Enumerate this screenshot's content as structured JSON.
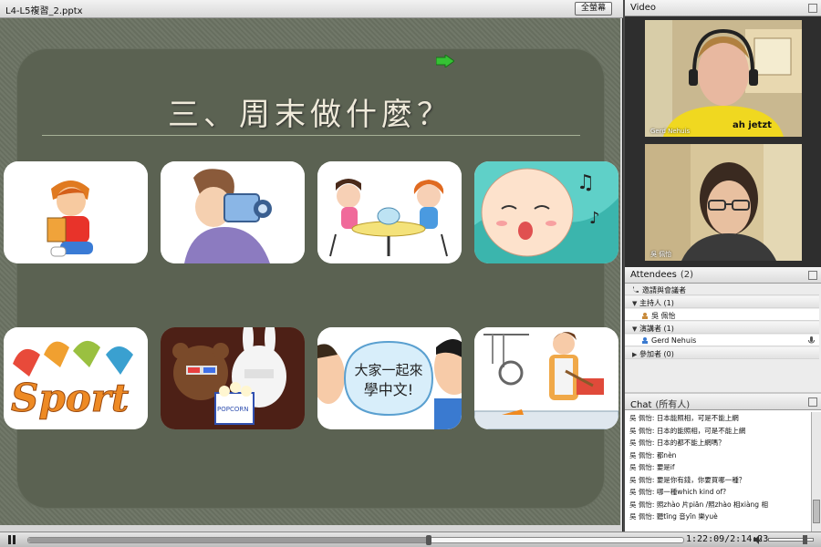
{
  "presentation": {
    "file_title": "L4-L5複習_2.pptx",
    "fullscreen_label": "全螢幕",
    "slide_heading": "三、周末做什麼？",
    "cards": [
      {
        "name": "reading-boy",
        "text": ""
      },
      {
        "name": "video-camera",
        "text": ""
      },
      {
        "name": "tea-party",
        "text": ""
      },
      {
        "name": "singing-face",
        "text": ""
      },
      {
        "name": "sport",
        "text": "Sport"
      },
      {
        "name": "movie-popcorn",
        "text": "POPCORN"
      },
      {
        "name": "learn-chinese",
        "line1": "大家一起來",
        "line2": "學中文!"
      },
      {
        "name": "cooking",
        "text": ""
      }
    ]
  },
  "playback": {
    "time_label": "1:22:09/2:14:23",
    "progress": 0.611,
    "volume": 0.82
  },
  "video": {
    "panel_title": "Video",
    "participants": [
      {
        "name": "Gerd Nehuis",
        "shirt_text": "ah jetzt"
      },
      {
        "name": "吳 佩怡"
      }
    ]
  },
  "attendees": {
    "panel_title": "Attendees",
    "count": "(2)",
    "invite_label": "邀請與會議者",
    "groups": [
      {
        "label": "主持人",
        "count": "(1)",
        "members": [
          "吳 佩怡"
        ]
      },
      {
        "label": "演講者",
        "count": "(1)",
        "members": [
          "Gerd Nehuis"
        ]
      },
      {
        "label": "參加者",
        "count": "(0)",
        "members": []
      }
    ]
  },
  "chat": {
    "panel_title": "Chat",
    "scope": "(所有人)",
    "messages": [
      {
        "who": "吳 佩怡:",
        "text": "日本能照相，可是不能上網"
      },
      {
        "who": "吳 佩怡:",
        "text": "日本的能照相，可是不能上網"
      },
      {
        "who": "吳 佩怡:",
        "text": "日本的都不能上網嗎？"
      },
      {
        "who": "吳 佩怡:",
        "text": "都nèn"
      },
      {
        "who": "吳 佩怡:",
        "text": "要是if"
      },
      {
        "who": "吳 佩怡:",
        "text": "要是你有錢，你要買哪一種？"
      },
      {
        "who": "吳 佩怡:",
        "text": "哪一種which kind of?"
      },
      {
        "who": "吳 佩怡:",
        "text": "照zhào 片piān /照zhào 相xiàng 相"
      },
      {
        "who": "吳 佩怡:",
        "text": "聽tīng 音yīn 樂yuè"
      }
    ]
  },
  "colors": {
    "slide_bg": "#6b7363",
    "heading": "#efeada",
    "panel_header": "#dcdcdc"
  }
}
